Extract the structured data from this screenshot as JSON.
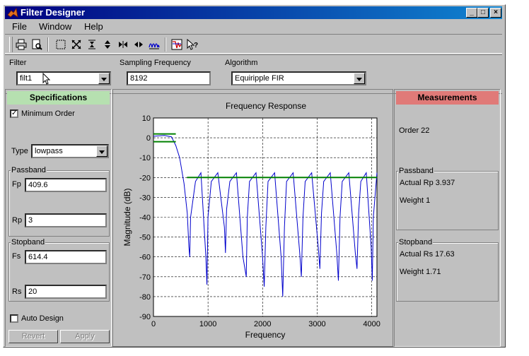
{
  "window": {
    "title": "Filter Designer"
  },
  "menu": {
    "file": "File",
    "window": "Window",
    "help": "Help"
  },
  "toolbar_icons": [
    "print-icon",
    "print-preview-icon",
    "zoom-box-icon",
    "zoom-xy-icon",
    "zoom-x-icon",
    "zoom-y-icon",
    "full-view-x-icon",
    "full-view-y-icon",
    "pass-band-icon",
    "spectrum-icon",
    "whats-this-icon"
  ],
  "filter_bar": {
    "filter_label": "Filter",
    "filter_value": "filt1",
    "sampling_label": "Sampling Frequency",
    "sampling_value": "8192",
    "algorithm_label": "Algorithm",
    "algorithm_value": "Equiripple FIR"
  },
  "specifications": {
    "title": "Specifications",
    "minimum_order_label": "Minimum Order",
    "minimum_order_checked": true,
    "type_label": "Type",
    "type_value": "lowpass",
    "passband_title": "Passband",
    "fp_label": "Fp",
    "fp_value": "409.6",
    "rp_label": "Rp",
    "rp_value": "3",
    "stopband_title": "Stopband",
    "fs_label": "Fs",
    "fs_value": "614.4",
    "rs_label": "Rs",
    "rs_value": "20",
    "auto_design_label": "Auto Design",
    "auto_design_checked": false,
    "revert_label": "Revert",
    "apply_label": "Apply"
  },
  "measurements": {
    "title": "Measurements",
    "order_text": "Order 22",
    "passband_title": "Passband",
    "actual_rp": "Actual Rp  3.937",
    "passband_weight": "Weight  1",
    "stopband_title": "Stopband",
    "actual_rs": "Actual Rs  17.63",
    "stopband_weight": "Weight  1.71"
  },
  "colors": {
    "specifications_header": "#b6e0b0",
    "measurements_header": "#e07a78",
    "response_line": "#0000cc",
    "spec_line": "#008000"
  },
  "chart_data": {
    "type": "line",
    "title": "Frequency Response",
    "xlabel": "Frequency",
    "ylabel": "Magnitude (dB)",
    "xlim": [
      0,
      4096
    ],
    "ylim": [
      -90,
      10
    ],
    "x_ticks": [
      0,
      1000,
      2000,
      3000,
      4000
    ],
    "y_ticks": [
      10,
      0,
      -10,
      -20,
      -30,
      -40,
      -50,
      -60,
      -70,
      -80,
      -90
    ],
    "grid": true,
    "series": [
      {
        "x": [
          0,
          200,
          330,
          410,
          480,
          560,
          620,
          650,
          665,
          680,
          770,
          870,
          960,
          980,
          1000,
          1060,
          1180,
          1300,
          1320,
          1340,
          1400,
          1520,
          1640,
          1700,
          1720,
          1760,
          1880,
          2000,
          2030,
          2060,
          2100,
          2220,
          2340,
          2370,
          2400,
          2440,
          2560,
          2680,
          2710,
          2740,
          2780,
          2900,
          3020,
          3050,
          3080,
          3120,
          3240,
          3360,
          3390,
          3420,
          3460,
          3580,
          3700,
          3730,
          3760,
          3800,
          3900,
          3990,
          4010,
          4030,
          4096
        ],
        "y": [
          0.8,
          1.2,
          0.5,
          -3.9,
          -10,
          -23,
          -38,
          -55,
          -60,
          -40,
          -22,
          -17.6,
          -60,
          -74,
          -40,
          -22,
          -17.6,
          -45,
          -58,
          -36,
          -22,
          -17.6,
          -60,
          -70,
          -40,
          -22,
          -17.6,
          -60,
          -75,
          -45,
          -22,
          -17.6,
          -60,
          -80,
          -45,
          -22,
          -17.6,
          -58,
          -70,
          -40,
          -22,
          -17.6,
          -55,
          -66,
          -38,
          -22,
          -17.6,
          -58,
          -72,
          -40,
          -22,
          -17.6,
          -58,
          -66,
          -38,
          -22,
          -17.6,
          -55,
          -72,
          -40,
          -17.6
        ]
      },
      {
        "x": [
          0,
          409.6
        ],
        "y": [
          1.9685,
          1.9685
        ]
      },
      {
        "x": [
          0,
          409.6
        ],
        "y": [
          -1.9685,
          -1.9685
        ]
      },
      {
        "x": [
          614.4,
          4096
        ],
        "y": [
          -20,
          -20
        ]
      }
    ]
  }
}
